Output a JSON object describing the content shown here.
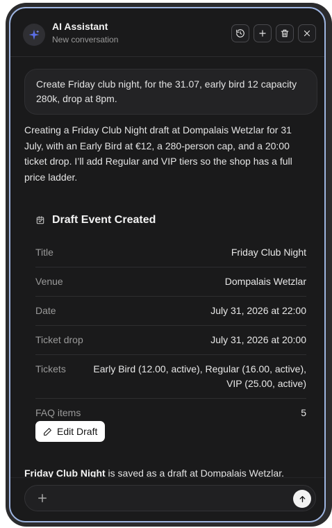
{
  "header": {
    "title": "AI Assistant",
    "subtitle": "New conversation",
    "buttons": [
      "history-icon",
      "plus-icon",
      "trash-icon",
      "close-icon"
    ]
  },
  "messages": {
    "user": "Create Friday club night, for the 31.07, early bird 12 capacity 280k, drop at 8pm.",
    "assistant": "Creating a Friday Club Night draft at Dompalais Wetzlar for 31 July, with an Early Bird at €12, a 280-person cap, and a 20:00 ticket drop. I’ll add Regular and VIP tiers so the shop has a full price ladder."
  },
  "card": {
    "icon": "calendar-icon",
    "title": "Draft Event Created",
    "rows": [
      {
        "label": "Title",
        "value": "Friday Club Night"
      },
      {
        "label": "Venue",
        "value": "Dompalais Wetzlar"
      },
      {
        "label": "Date",
        "value": "July 31, 2026 at 22:00"
      },
      {
        "label": "Ticket drop",
        "value": "July 31, 2026 at 20:00"
      },
      {
        "label": "Tickets",
        "value": "Early Bird (12.00, active), Regular (16.00, active), VIP (25.00, active)"
      },
      {
        "label": "FAQ items",
        "value": "5"
      }
    ],
    "edit_label": "Edit Draft"
  },
  "summary": {
    "bold": "Friday Club Night",
    "rest": " is saved as a draft at Dompalais Wetzlar."
  },
  "input": {
    "placeholder": ""
  },
  "colors": {
    "accent": "#9fb6e2",
    "background": "#1a1a1b"
  }
}
